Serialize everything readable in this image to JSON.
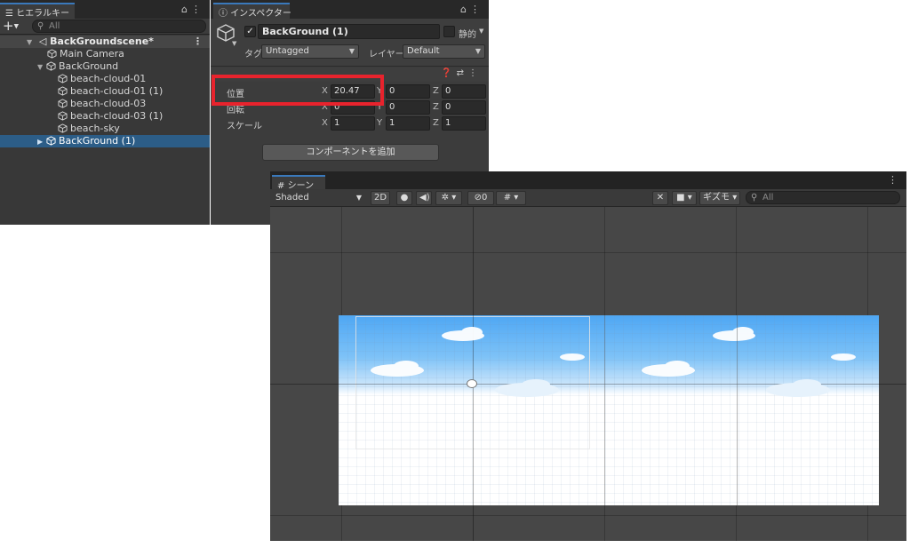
{
  "hierarchy": {
    "tab_label": "ヒエラルキー",
    "lock_icon": "lock-icon",
    "menu_icon": "kebab-icon",
    "add_label": "+",
    "search_placeholder": "All",
    "scene_name": "BackGroundscene*",
    "items": [
      {
        "label": "Main Camera"
      },
      {
        "label": "BackGround"
      },
      {
        "label": "beach-cloud-01"
      },
      {
        "label": "beach-cloud-01 (1)"
      },
      {
        "label": "beach-cloud-03"
      },
      {
        "label": "beach-cloud-03 (1)"
      },
      {
        "label": "beach-sky"
      },
      {
        "label": "BackGround (1)"
      }
    ]
  },
  "inspector": {
    "tab_label": "インスペクター",
    "object_name": "BackGround (1)",
    "static_label": "静的",
    "tag_label": "タグ",
    "tag_value": "Untagged",
    "layer_label": "レイヤー",
    "layer_value": "Default",
    "transform": {
      "position_label": "位置",
      "rotation_label": "回転",
      "scale_label": "スケール",
      "position": {
        "x": "20.47",
        "y": "0",
        "z": "0"
      },
      "rotation": {
        "x": "0",
        "y": "0",
        "z": "0"
      },
      "scale": {
        "x": "1",
        "y": "1",
        "z": "1"
      },
      "axis_x": "X",
      "axis_y": "Y",
      "axis_z": "Z"
    },
    "add_component_label": "コンポーネントを追加"
  },
  "scene": {
    "tab_label": "シーン",
    "shading_mode": "Shaded",
    "mode_2d": "2D",
    "hidden_count": "0",
    "gizmos_label": "ギズモ",
    "search_placeholder": "All"
  },
  "colors": {
    "highlight": "#e8232d",
    "selection": "#2c5d87",
    "sky_top": "#4ea7f4"
  }
}
